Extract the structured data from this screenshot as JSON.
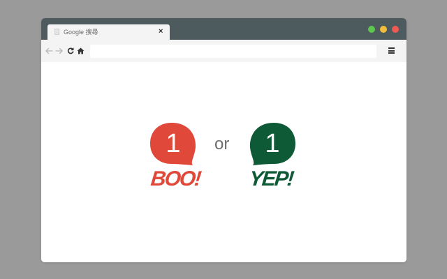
{
  "browser": {
    "tab": {
      "title": "Google 搜尋",
      "close_label": "×"
    },
    "window_controls": {
      "colors": [
        "#5ec84e",
        "#f2bd3c",
        "#ef5b52"
      ]
    },
    "toolbar": {
      "back_icon": "arrow-left-icon",
      "forward_icon": "arrow-right-icon",
      "reload_icon": "reload-icon",
      "home_icon": "home-icon",
      "address_value": "",
      "menu_icon": "hamburger-menu-icon"
    },
    "colors": {
      "frame": "#4d5b5e",
      "toolbar": "#f4f4f4",
      "backdrop": "#9a9a9a"
    }
  },
  "content": {
    "boo": {
      "count": "1",
      "label": "BOO!",
      "color": "#e0483a"
    },
    "separator": "or",
    "yep": {
      "count": "1",
      "label": "YEP!",
      "color": "#0f5a36"
    }
  }
}
